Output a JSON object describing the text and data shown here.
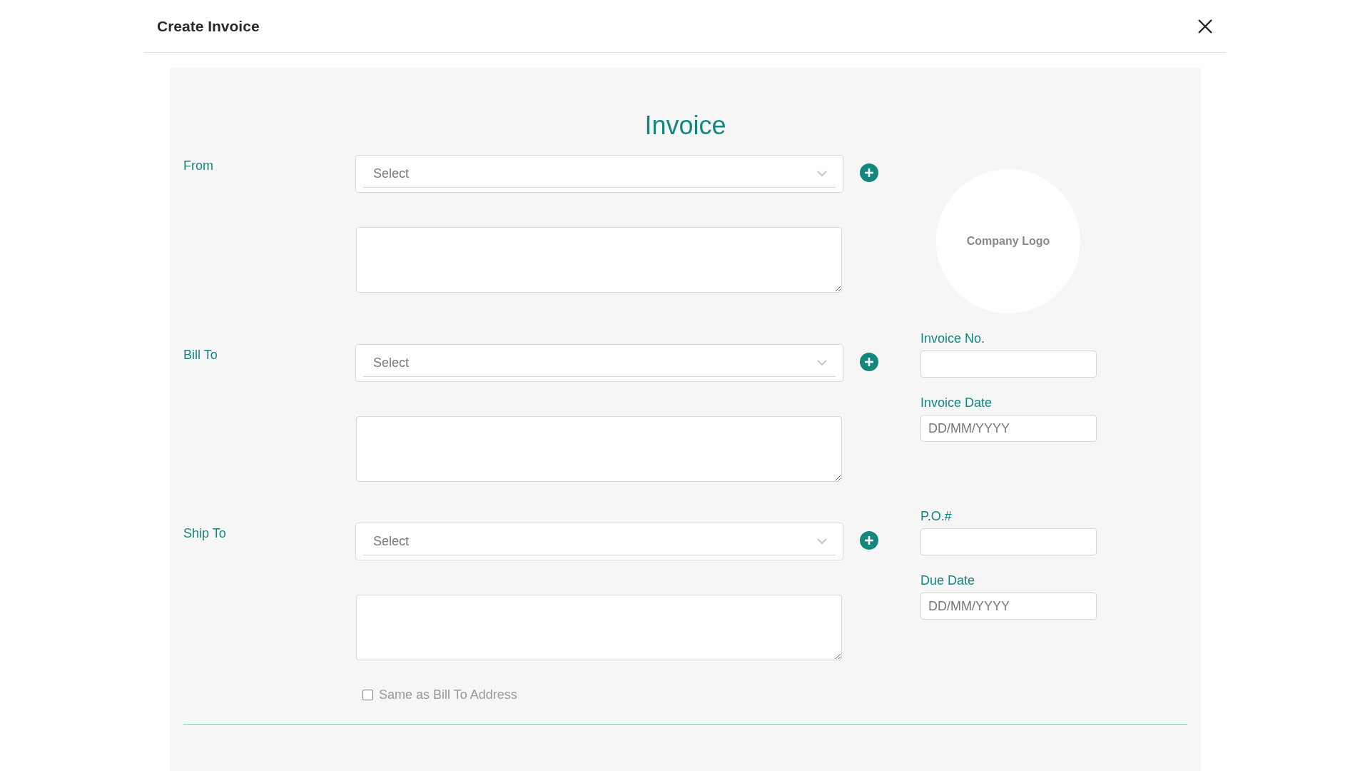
{
  "dialog": {
    "title": "Create Invoice"
  },
  "heading": "Invoice",
  "parties": [
    {
      "label": "From",
      "select": {
        "placeholder": "Select"
      }
    },
    {
      "label": "Bill To",
      "select": {
        "placeholder": "Select"
      }
    },
    {
      "label": "Ship To",
      "select": {
        "placeholder": "Select"
      }
    }
  ],
  "same_as_bill_to": {
    "label": "Same as Bill To Address",
    "checked": false
  },
  "logo": {
    "label": "Company Logo"
  },
  "fields": [
    {
      "label": "Invoice No."
    },
    {
      "label": "Invoice Date",
      "placeholder": "DD/MM/YYYY"
    },
    {
      "label": "P.O.#"
    },
    {
      "label": "Due Date",
      "placeholder": "DD/MM/YYYY"
    }
  ]
}
